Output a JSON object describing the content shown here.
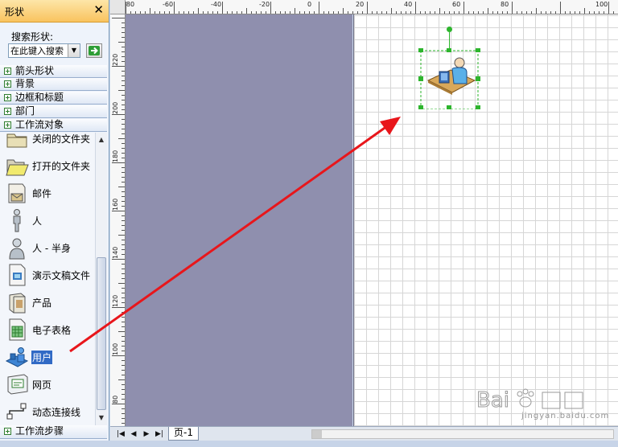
{
  "shapes_pane": {
    "title": "形状",
    "close_glyph": "✕",
    "search_label": "搜索形状:",
    "search_value": "在此键入搜索",
    "dropdown_glyph": "▼",
    "go_icon": "green-arrow-icon",
    "stencils": [
      {
        "label": "箭头形状"
      },
      {
        "label": "背景"
      },
      {
        "label": "边框和标题"
      },
      {
        "label": "部门"
      },
      {
        "label": "工作流对象"
      }
    ],
    "footer_stencil": "工作流步骤",
    "shapes": [
      {
        "label": "关闭的文件夹",
        "icon": "closed-folder-icon"
      },
      {
        "label": "打开的文件夹",
        "icon": "open-folder-icon"
      },
      {
        "label": "邮件",
        "icon": "mail-icon"
      },
      {
        "label": "人",
        "icon": "person-icon"
      },
      {
        "label": "人 - 半身",
        "icon": "person-half-body-icon"
      },
      {
        "label": "演示文稿文件",
        "icon": "presentation-file-icon"
      },
      {
        "label": "产品",
        "icon": "product-icon"
      },
      {
        "label": "电子表格",
        "icon": "spreadsheet-icon"
      },
      {
        "label": "用户",
        "icon": "user-icon",
        "selected": true
      },
      {
        "label": "网页",
        "icon": "web-page-icon"
      },
      {
        "label": "动态连接线",
        "icon": "dynamic-connector-icon"
      }
    ]
  },
  "rulers": {
    "top": [
      "-80",
      "-60",
      "-40",
      "-20",
      "0",
      "20",
      "40",
      "60",
      "80",
      "100"
    ],
    "left": [
      "220",
      "200",
      "180",
      "160",
      "140",
      "120",
      "100",
      "80"
    ]
  },
  "page_tabs": {
    "nav": [
      "|◀",
      "◀",
      "▶",
      "▶|"
    ],
    "page_label": "页-1"
  },
  "watermark": {
    "text": "jingyan.baidu.com"
  },
  "colors": {
    "arrow": "#e8161b",
    "offpage": "#8f8fae",
    "selection_handles": "#2db52d",
    "header_orange": "#f9c35f"
  }
}
